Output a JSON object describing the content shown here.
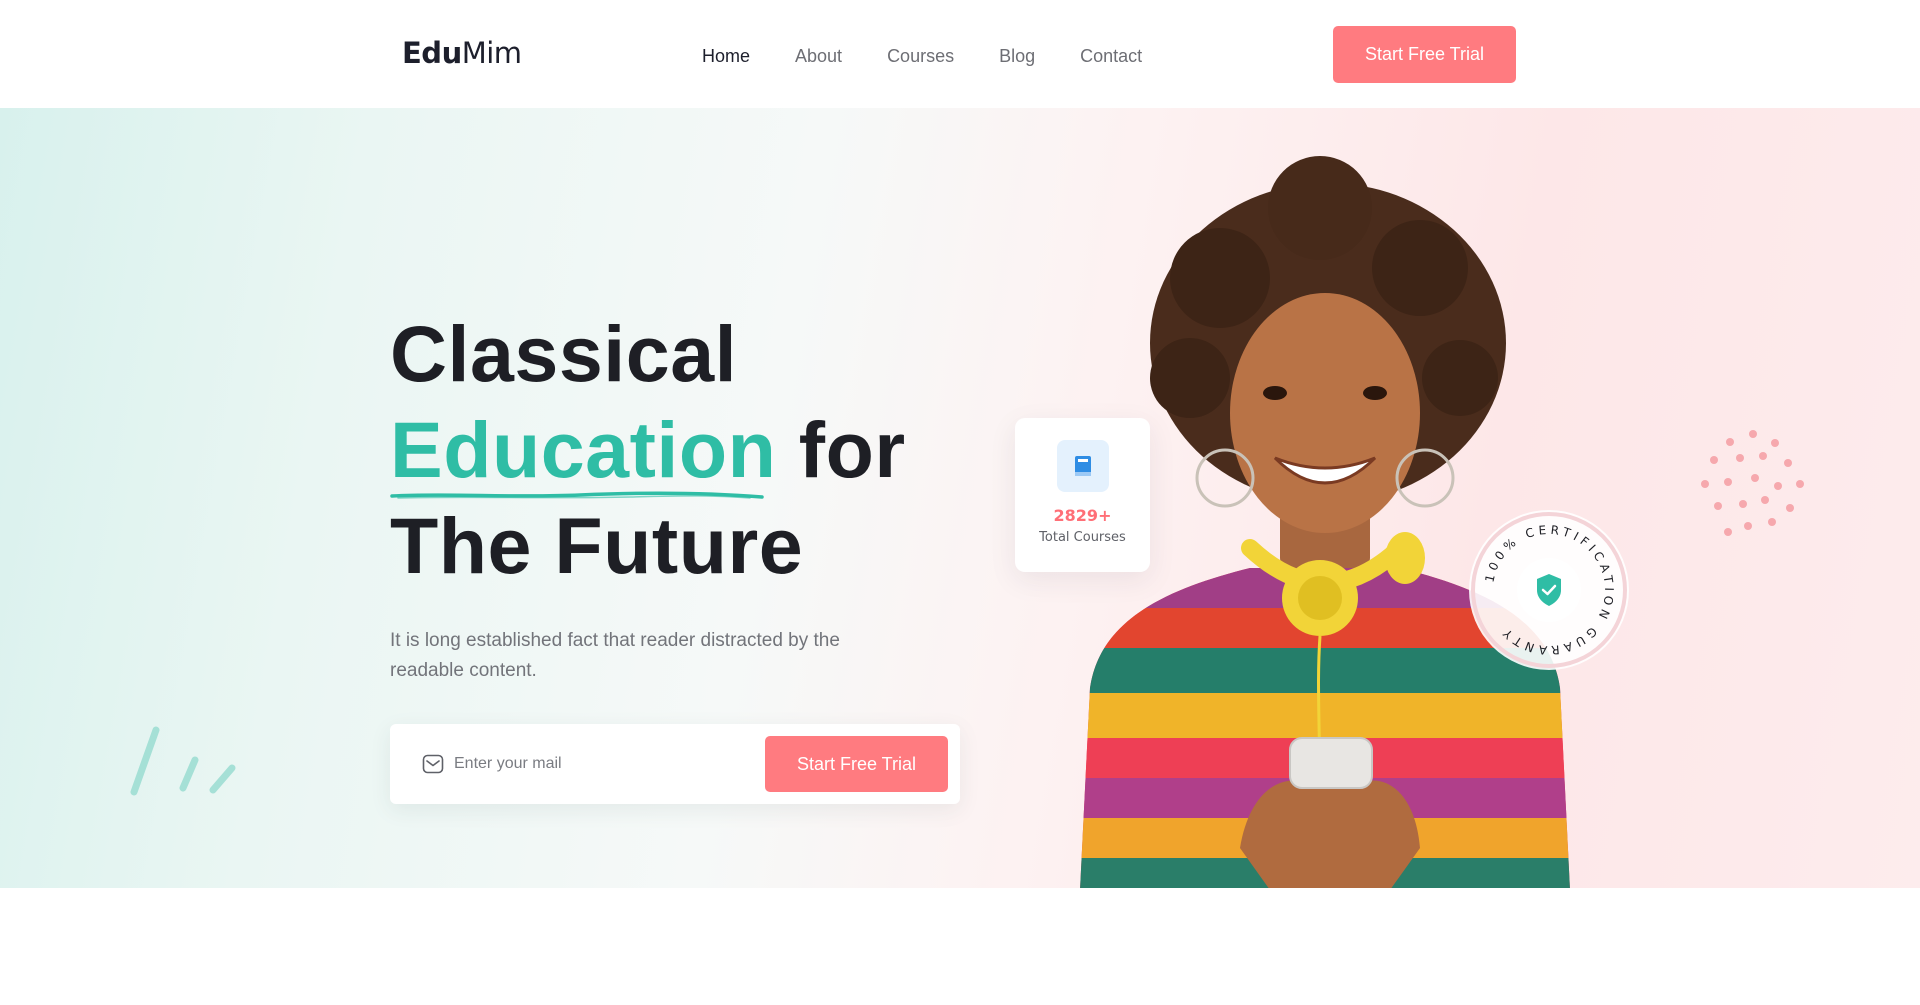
{
  "header": {
    "logo_bold": "Edu",
    "logo_rest": "Mim",
    "nav": [
      {
        "label": "Home",
        "active": true
      },
      {
        "label": "About"
      },
      {
        "label": "Courses"
      },
      {
        "label": "Blog"
      },
      {
        "label": "Contact"
      }
    ],
    "cta_label": "Start Free Trial"
  },
  "hero": {
    "title_line1": "Classical",
    "title_accent": "Education",
    "title_line2_rest": " for",
    "title_line3": "The Future",
    "description": "It is long established fact that reader distracted by the readable content.",
    "subscribe": {
      "placeholder": "Enter your mail",
      "cta_label": "Start Free Trial"
    },
    "stat_card": {
      "value": "2829+",
      "label": "Total Courses"
    },
    "badge_text": "100% CERTIFICATION GUARANTY ",
    "colors": {
      "accent": "#2fbda5",
      "cta": "#ff7b80",
      "heading": "#1e1f25"
    }
  }
}
